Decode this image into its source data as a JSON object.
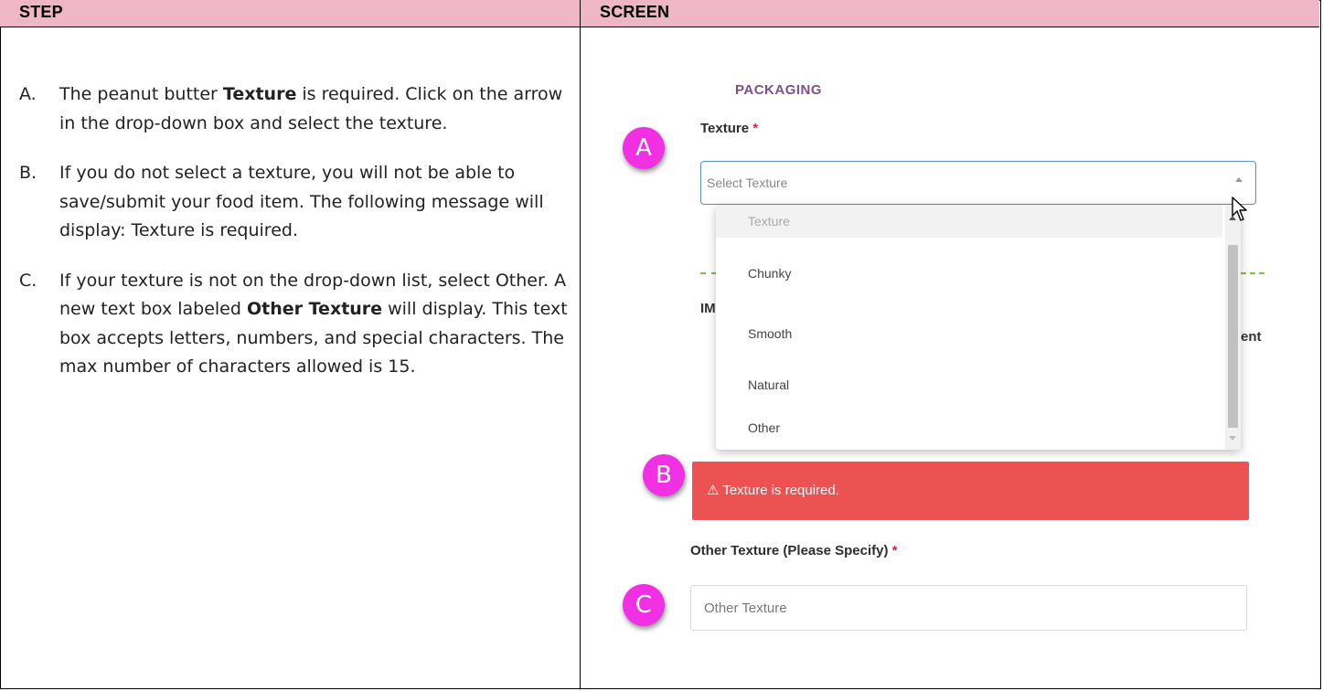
{
  "header": {
    "step": "STEP",
    "screen": "SCREEN"
  },
  "steps": [
    {
      "letter": "A.",
      "lines": [
        "The peanut butter ",
        "Texture",
        " is required. Click on the arrow in the drop-down box and select the texture."
      ]
    },
    {
      "letter": "B.",
      "text": "If you do not select a texture, you will not be able to save/submit your food item. The following message will display: Texture is required."
    },
    {
      "letter": "C.",
      "parts": [
        "If your texture is not on the drop-down list, select Other.  A new text box labeled ",
        "Other Texture",
        " will display.  This text box accepts letters, numbers, and special characters.  The max number of characters allowed is 15."
      ]
    }
  ],
  "screen": {
    "section_title": "PACKAGING",
    "texture_label": "Texture",
    "required_mark": "*",
    "select_placeholder": "Select Texture",
    "dropdown_options": [
      "Texture",
      "Chunky",
      "Smooth",
      "Natural",
      "Other"
    ],
    "background_fragments": {
      "section_partial": "IM",
      "label_partial": "ent"
    },
    "alert_text": "⚠ Texture is required.",
    "other_label": "Other Texture (Please Specify)",
    "other_placeholder": "Other Texture",
    "badges": [
      "A",
      "B",
      "C"
    ],
    "colors": {
      "header_bg": "#efb6c8",
      "badge": "#f230e3",
      "alert": "#ec5252",
      "section_title": "#7d4f8e",
      "focus_border": "#5a8fc5"
    }
  }
}
